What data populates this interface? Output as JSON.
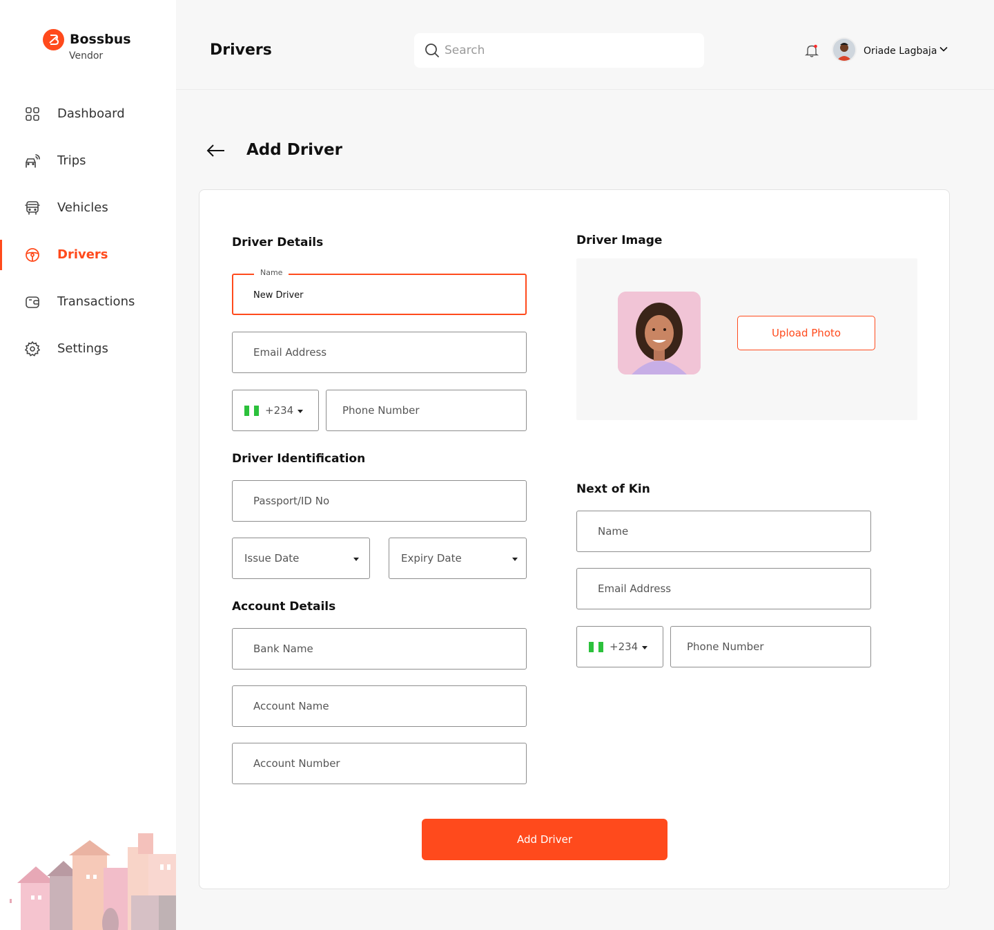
{
  "brand": {
    "name": "Bossbus",
    "subtitle": "Vendor"
  },
  "sidebar": {
    "items": [
      {
        "label": "Dashboard",
        "icon": "grid-icon"
      },
      {
        "label": "Trips",
        "icon": "car-signal-icon"
      },
      {
        "label": "Vehicles",
        "icon": "bus-icon"
      },
      {
        "label": "Drivers",
        "icon": "steering-wheel-icon",
        "active": true
      },
      {
        "label": "Transactions",
        "icon": "wallet-icon"
      },
      {
        "label": "Settings",
        "icon": "gear-icon"
      }
    ]
  },
  "header": {
    "title": "Drivers",
    "search_placeholder": "Search",
    "user_name": "Oriade Lagbaja"
  },
  "page": {
    "heading": "Add Driver"
  },
  "driver_details": {
    "title": "Driver Details",
    "name_label": "Name",
    "name_value": "New Driver",
    "email_placeholder": "Email Address",
    "country_code": "+234",
    "phone_placeholder": "Phone Number"
  },
  "driver_identification": {
    "title": "Driver Identification",
    "passport_placeholder": "Passport/ID No",
    "issue_date": "Issue Date",
    "expiry_date": "Expiry Date"
  },
  "account_details": {
    "title": "Account Details",
    "bank_placeholder": "Bank Name",
    "account_name_placeholder": "Account Name",
    "account_number_placeholder": "Account Number"
  },
  "driver_image": {
    "title": "Driver Image",
    "upload_label": "Upload Photo"
  },
  "next_of_kin": {
    "title": "Next of Kin",
    "name_placeholder": "Name",
    "email_placeholder": "Email Address",
    "country_code": "+234",
    "phone_placeholder": "Phone Number"
  },
  "actions": {
    "submit_label": "Add Driver"
  },
  "colors": {
    "accent": "#ff4a1c",
    "flag_green": "#2cc13c",
    "background": "#f7f7f7"
  }
}
